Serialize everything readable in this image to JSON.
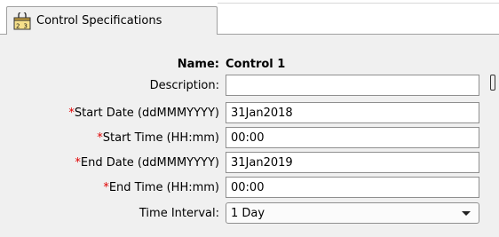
{
  "tab": {
    "label": "Control Specifications",
    "icon": "calendar-icon"
  },
  "form": {
    "name_label": "Name:",
    "name_value": "Control 1",
    "description_label": "Description:",
    "description_value": "",
    "start_date_label": "Start Date (ddMMMYYYY)",
    "start_date_value": "31Jan2018",
    "start_time_label": "Start Time (HH:mm)",
    "start_time_value": "00:00",
    "end_date_label": "End Date (ddMMMYYYY)",
    "end_date_value": "31Jan2019",
    "end_time_label": "End Time (HH:mm)",
    "end_time_value": "00:00",
    "time_interval_label": "Time Interval:",
    "time_interval_value": "1 Day",
    "required_marker": "*"
  },
  "colors": {
    "required": "#e00000",
    "panel_bg": "#f0f0f0"
  }
}
